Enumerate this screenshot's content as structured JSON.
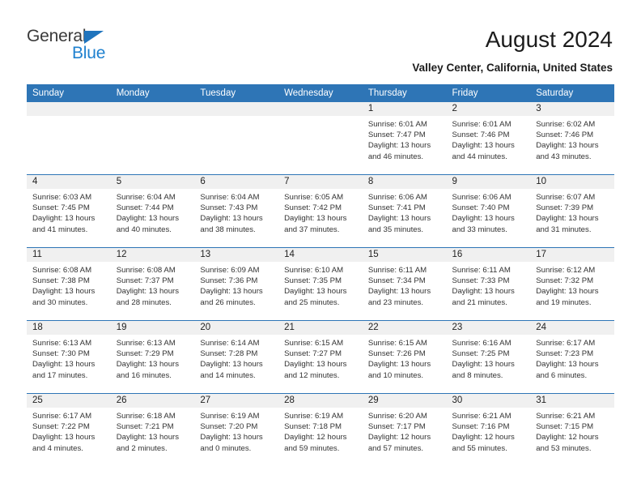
{
  "brand": {
    "name_top": "General",
    "name_bottom": "Blue",
    "triangle_color": "#1f74bd",
    "blue_color": "#1f81cf",
    "gray_color": "#3a3a3a"
  },
  "header": {
    "title": "August 2024",
    "subtitle": "Valley Center, California, United States"
  },
  "colors": {
    "header_blue": "#2e75b6",
    "daynum_band": "#f0f0f0",
    "text": "#222222"
  },
  "calendar": {
    "weekday_headers": [
      "Sunday",
      "Monday",
      "Tuesday",
      "Wednesday",
      "Thursday",
      "Friday",
      "Saturday"
    ],
    "labels": {
      "sunrise": "Sunrise:",
      "sunset": "Sunset:",
      "daylight": "Daylight:"
    },
    "weeks": [
      [
        {
          "day": "",
          "empty": true
        },
        {
          "day": "",
          "empty": true
        },
        {
          "day": "",
          "empty": true
        },
        {
          "day": "",
          "empty": true
        },
        {
          "day": "1",
          "sunrise": "Sunrise: 6:01 AM",
          "sunset": "Sunset: 7:47 PM",
          "daylight_l1": "Daylight: 13 hours",
          "daylight_l2": "and 46 minutes."
        },
        {
          "day": "2",
          "sunrise": "Sunrise: 6:01 AM",
          "sunset": "Sunset: 7:46 PM",
          "daylight_l1": "Daylight: 13 hours",
          "daylight_l2": "and 44 minutes."
        },
        {
          "day": "3",
          "sunrise": "Sunrise: 6:02 AM",
          "sunset": "Sunset: 7:46 PM",
          "daylight_l1": "Daylight: 13 hours",
          "daylight_l2": "and 43 minutes."
        }
      ],
      [
        {
          "day": "4",
          "sunrise": "Sunrise: 6:03 AM",
          "sunset": "Sunset: 7:45 PM",
          "daylight_l1": "Daylight: 13 hours",
          "daylight_l2": "and 41 minutes."
        },
        {
          "day": "5",
          "sunrise": "Sunrise: 6:04 AM",
          "sunset": "Sunset: 7:44 PM",
          "daylight_l1": "Daylight: 13 hours",
          "daylight_l2": "and 40 minutes."
        },
        {
          "day": "6",
          "sunrise": "Sunrise: 6:04 AM",
          "sunset": "Sunset: 7:43 PM",
          "daylight_l1": "Daylight: 13 hours",
          "daylight_l2": "and 38 minutes."
        },
        {
          "day": "7",
          "sunrise": "Sunrise: 6:05 AM",
          "sunset": "Sunset: 7:42 PM",
          "daylight_l1": "Daylight: 13 hours",
          "daylight_l2": "and 37 minutes."
        },
        {
          "day": "8",
          "sunrise": "Sunrise: 6:06 AM",
          "sunset": "Sunset: 7:41 PM",
          "daylight_l1": "Daylight: 13 hours",
          "daylight_l2": "and 35 minutes."
        },
        {
          "day": "9",
          "sunrise": "Sunrise: 6:06 AM",
          "sunset": "Sunset: 7:40 PM",
          "daylight_l1": "Daylight: 13 hours",
          "daylight_l2": "and 33 minutes."
        },
        {
          "day": "10",
          "sunrise": "Sunrise: 6:07 AM",
          "sunset": "Sunset: 7:39 PM",
          "daylight_l1": "Daylight: 13 hours",
          "daylight_l2": "and 31 minutes."
        }
      ],
      [
        {
          "day": "11",
          "sunrise": "Sunrise: 6:08 AM",
          "sunset": "Sunset: 7:38 PM",
          "daylight_l1": "Daylight: 13 hours",
          "daylight_l2": "and 30 minutes."
        },
        {
          "day": "12",
          "sunrise": "Sunrise: 6:08 AM",
          "sunset": "Sunset: 7:37 PM",
          "daylight_l1": "Daylight: 13 hours",
          "daylight_l2": "and 28 minutes."
        },
        {
          "day": "13",
          "sunrise": "Sunrise: 6:09 AM",
          "sunset": "Sunset: 7:36 PM",
          "daylight_l1": "Daylight: 13 hours",
          "daylight_l2": "and 26 minutes."
        },
        {
          "day": "14",
          "sunrise": "Sunrise: 6:10 AM",
          "sunset": "Sunset: 7:35 PM",
          "daylight_l1": "Daylight: 13 hours",
          "daylight_l2": "and 25 minutes."
        },
        {
          "day": "15",
          "sunrise": "Sunrise: 6:11 AM",
          "sunset": "Sunset: 7:34 PM",
          "daylight_l1": "Daylight: 13 hours",
          "daylight_l2": "and 23 minutes."
        },
        {
          "day": "16",
          "sunrise": "Sunrise: 6:11 AM",
          "sunset": "Sunset: 7:33 PM",
          "daylight_l1": "Daylight: 13 hours",
          "daylight_l2": "and 21 minutes."
        },
        {
          "day": "17",
          "sunrise": "Sunrise: 6:12 AM",
          "sunset": "Sunset: 7:32 PM",
          "daylight_l1": "Daylight: 13 hours",
          "daylight_l2": "and 19 minutes."
        }
      ],
      [
        {
          "day": "18",
          "sunrise": "Sunrise: 6:13 AM",
          "sunset": "Sunset: 7:30 PM",
          "daylight_l1": "Daylight: 13 hours",
          "daylight_l2": "and 17 minutes."
        },
        {
          "day": "19",
          "sunrise": "Sunrise: 6:13 AM",
          "sunset": "Sunset: 7:29 PM",
          "daylight_l1": "Daylight: 13 hours",
          "daylight_l2": "and 16 minutes."
        },
        {
          "day": "20",
          "sunrise": "Sunrise: 6:14 AM",
          "sunset": "Sunset: 7:28 PM",
          "daylight_l1": "Daylight: 13 hours",
          "daylight_l2": "and 14 minutes."
        },
        {
          "day": "21",
          "sunrise": "Sunrise: 6:15 AM",
          "sunset": "Sunset: 7:27 PM",
          "daylight_l1": "Daylight: 13 hours",
          "daylight_l2": "and 12 minutes."
        },
        {
          "day": "22",
          "sunrise": "Sunrise: 6:15 AM",
          "sunset": "Sunset: 7:26 PM",
          "daylight_l1": "Daylight: 13 hours",
          "daylight_l2": "and 10 minutes."
        },
        {
          "day": "23",
          "sunrise": "Sunrise: 6:16 AM",
          "sunset": "Sunset: 7:25 PM",
          "daylight_l1": "Daylight: 13 hours",
          "daylight_l2": "and 8 minutes."
        },
        {
          "day": "24",
          "sunrise": "Sunrise: 6:17 AM",
          "sunset": "Sunset: 7:23 PM",
          "daylight_l1": "Daylight: 13 hours",
          "daylight_l2": "and 6 minutes."
        }
      ],
      [
        {
          "day": "25",
          "sunrise": "Sunrise: 6:17 AM",
          "sunset": "Sunset: 7:22 PM",
          "daylight_l1": "Daylight: 13 hours",
          "daylight_l2": "and 4 minutes."
        },
        {
          "day": "26",
          "sunrise": "Sunrise: 6:18 AM",
          "sunset": "Sunset: 7:21 PM",
          "daylight_l1": "Daylight: 13 hours",
          "daylight_l2": "and 2 minutes."
        },
        {
          "day": "27",
          "sunrise": "Sunrise: 6:19 AM",
          "sunset": "Sunset: 7:20 PM",
          "daylight_l1": "Daylight: 13 hours",
          "daylight_l2": "and 0 minutes."
        },
        {
          "day": "28",
          "sunrise": "Sunrise: 6:19 AM",
          "sunset": "Sunset: 7:18 PM",
          "daylight_l1": "Daylight: 12 hours",
          "daylight_l2": "and 59 minutes."
        },
        {
          "day": "29",
          "sunrise": "Sunrise: 6:20 AM",
          "sunset": "Sunset: 7:17 PM",
          "daylight_l1": "Daylight: 12 hours",
          "daylight_l2": "and 57 minutes."
        },
        {
          "day": "30",
          "sunrise": "Sunrise: 6:21 AM",
          "sunset": "Sunset: 7:16 PM",
          "daylight_l1": "Daylight: 12 hours",
          "daylight_l2": "and 55 minutes."
        },
        {
          "day": "31",
          "sunrise": "Sunrise: 6:21 AM",
          "sunset": "Sunset: 7:15 PM",
          "daylight_l1": "Daylight: 12 hours",
          "daylight_l2": "and 53 minutes."
        }
      ]
    ]
  }
}
